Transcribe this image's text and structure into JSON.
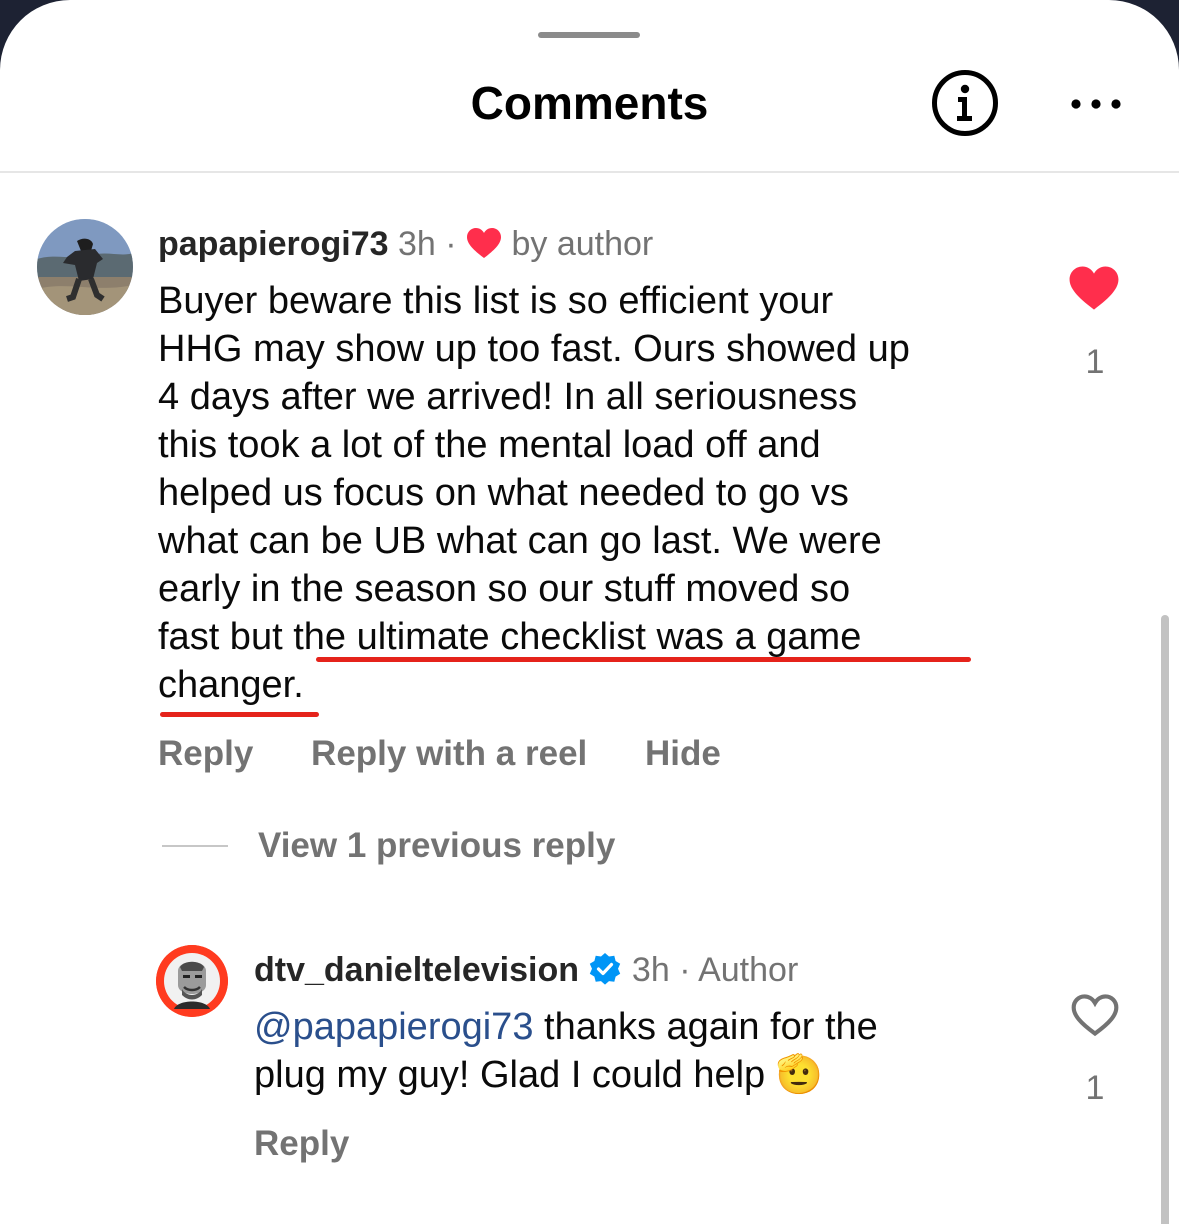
{
  "header": {
    "title": "Comments",
    "info_icon": "info-icon",
    "more_icon": "more-icon"
  },
  "comments": [
    {
      "username": "papapierogi73",
      "time": "3h",
      "separator": "·",
      "badge_icon": "heart-icon",
      "badge_label": "by author",
      "lines": [
        "Buyer beware this list is so efficient your",
        "HHG may show up too fast. Ours showed up",
        "4 days after we arrived! In all seriousness",
        "this took a lot of the mental load off and",
        "helped us focus on what needed to go vs",
        "what can be UB what can go last. We were",
        "early in the season so our stuff moved so"
      ],
      "line8_start": "fast but ",
      "line8_highlight": "the ultimate checklist was a game",
      "line9_highlight": "changer",
      "line9_end": ".",
      "actions": [
        "Reply",
        "Reply with a reel",
        "Hide"
      ],
      "liked": true,
      "like_count": "1",
      "accent_color": "#ff2e4c"
    }
  ],
  "view_replies_label": "View 1 previous reply",
  "reply": {
    "username": "dtv_danieltelevision",
    "verified_icon": "verified-badge-icon",
    "time": "3h",
    "separator": "·",
    "author_label": "Author",
    "mention": "@papapierogi73",
    "text_line1": " thanks again for the",
    "text_line2": "plug my guy!  Glad I could help ",
    "emoji": "🫡",
    "action": "Reply",
    "liked": false,
    "like_count": "1"
  },
  "annotation_color": "#e5231b",
  "mention_color": "#2a4f8c"
}
